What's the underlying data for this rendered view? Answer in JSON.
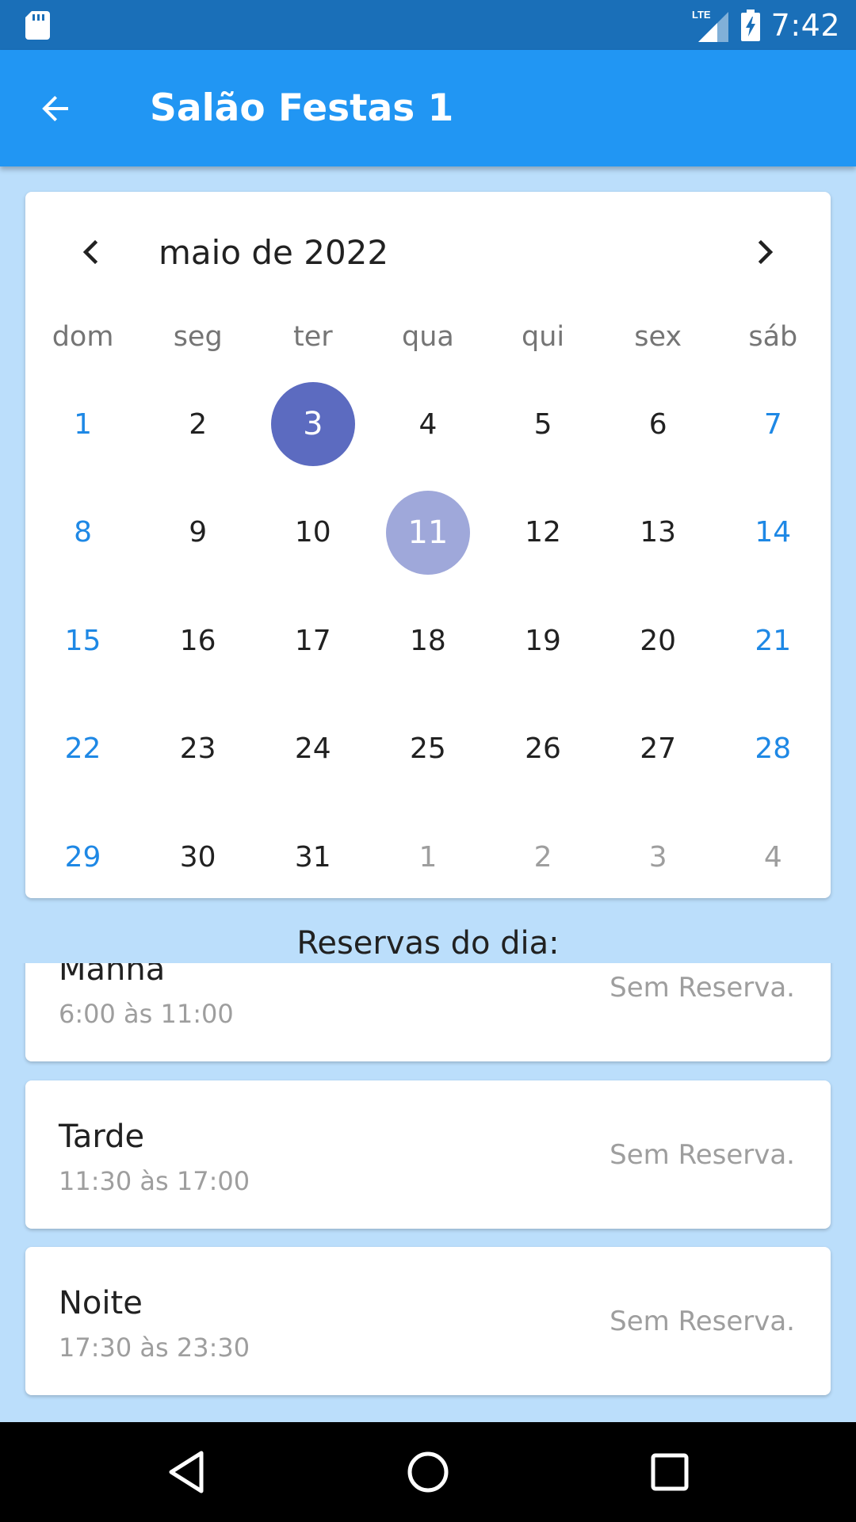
{
  "status_bar": {
    "network": "LTE",
    "time": "7:42"
  },
  "app_bar": {
    "title": "Salão Festas 1",
    "back_icon": "arrow-left-icon"
  },
  "calendar": {
    "month_title": "maio de 2022",
    "weekdays": [
      "dom",
      "seg",
      "ter",
      "qua",
      "qui",
      "sex",
      "sáb"
    ],
    "weeks": [
      [
        "1",
        "2",
        "3",
        "4",
        "5",
        "6",
        "7"
      ],
      [
        "8",
        "9",
        "10",
        "11",
        "12",
        "13",
        "14"
      ],
      [
        "15",
        "16",
        "17",
        "18",
        "19",
        "20",
        "21"
      ],
      [
        "22",
        "23",
        "24",
        "25",
        "26",
        "27",
        "28"
      ],
      [
        "29",
        "30",
        "31",
        "1",
        "2",
        "3",
        "4"
      ]
    ],
    "selected_day": "3",
    "today_day": "11",
    "colors": {
      "weekend": "#1E88E5",
      "outside_month": "#9E9E9E",
      "selected": "#5C6BC0",
      "today": "#9FA8DA"
    }
  },
  "reservations": {
    "title": "Reservas do dia:",
    "items": [
      {
        "name": "Manhã",
        "time": "6:00 às 11:00",
        "status": "Sem Reserva."
      },
      {
        "name": "Tarde",
        "time": "11:30 às 17:00",
        "status": "Sem Reserva."
      },
      {
        "name": "Noite",
        "time": "17:30 às 23:30",
        "status": "Sem Reserva."
      }
    ]
  },
  "colors": {
    "status_bar": "#1A6FB8",
    "app_bar": "#2196F3",
    "background": "#BBDEFB"
  }
}
